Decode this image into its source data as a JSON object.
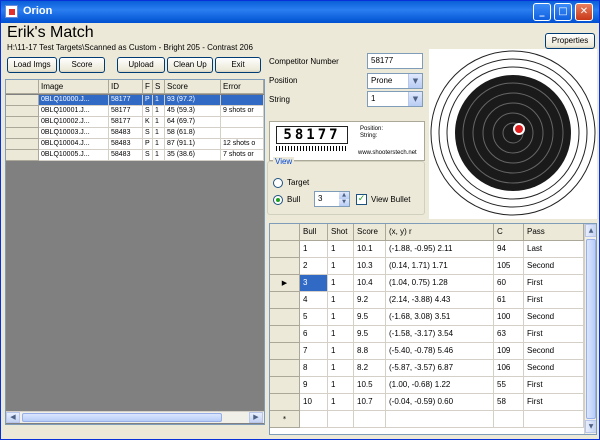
{
  "window": {
    "title": "Orion",
    "buttons": {
      "minimize": "_",
      "maximize": "□",
      "close": "✕"
    }
  },
  "header": {
    "title": "Erik's Match",
    "path": "H:\\11-17 Test Targets\\Scanned as Custom - Bright 205 - Contrast 206",
    "properties_label": "Properties"
  },
  "toolbar": {
    "load_label": "Load Imgs",
    "score_label": "Score",
    "upload_label": "Upload",
    "cleanup_label": "Clean Up",
    "exit_label": "Exit"
  },
  "image_list": {
    "columns": [
      "Image",
      "ID",
      "F",
      "S",
      "Score",
      "Error"
    ],
    "selected_index": 0,
    "rows": [
      {
        "image": "0BLQ10000.J...",
        "id": "58177",
        "f": "P",
        "s": "1",
        "score": "93 (97.2)",
        "error": ""
      },
      {
        "image": "0BLQ10001.J...",
        "id": "58177",
        "f": "S",
        "s": "1",
        "score": "45 (59.3)",
        "error": "9 shots or"
      },
      {
        "image": "0BLQ10002.J...",
        "id": "58177",
        "f": "K",
        "s": "1",
        "score": "64 (69.7)",
        "error": ""
      },
      {
        "image": "0BLQ10003.J...",
        "id": "58483",
        "f": "S",
        "s": "1",
        "score": "58 (61.8)",
        "error": ""
      },
      {
        "image": "0BLQ10004.J...",
        "id": "58483",
        "f": "P",
        "s": "1",
        "score": "87 (91.1)",
        "error": "12 shots o"
      },
      {
        "image": "0BLQ10005.J...",
        "id": "58483",
        "f": "S",
        "s": "1",
        "score": "35 (38.6)",
        "error": "7 shots or"
      }
    ]
  },
  "details": {
    "competitor_label": "Competitor Number",
    "competitor_value": "58177",
    "position_label": "Position",
    "position_value": "Prone",
    "string_label": "String",
    "string_value": "1",
    "scan_number": "58177",
    "scan_text1": "Position:",
    "scan_text2": "String:",
    "scan_url": "www.shooterstech.net"
  },
  "view": {
    "group_label": "View",
    "target_label": "Target",
    "bull_label": "Bull",
    "bull_value": "3",
    "view_bullet_label": "View Bullet",
    "selected": "bull",
    "view_bullet_checked": true
  },
  "shots": {
    "columns": [
      "Bull",
      "Shot",
      "Score",
      "(x, y) r",
      "C",
      "Pass"
    ],
    "current_row": 2,
    "rows": [
      {
        "bull": "1",
        "shot": "1",
        "score": "10.1",
        "xy": "(-1.88, -0.95) 2.11",
        "c": "94",
        "pass": "Last"
      },
      {
        "bull": "2",
        "shot": "1",
        "score": "10.3",
        "xy": "(0.14, 1.71) 1.71",
        "c": "105",
        "pass": "Second"
      },
      {
        "bull": "3",
        "shot": "1",
        "score": "10.4",
        "xy": "(1.04, 0.75) 1.28",
        "c": "60",
        "pass": "First"
      },
      {
        "bull": "4",
        "shot": "1",
        "score": "9.2",
        "xy": "(2.14, -3.88) 4.43",
        "c": "61",
        "pass": "First"
      },
      {
        "bull": "5",
        "shot": "1",
        "score": "9.5",
        "xy": "(-1.68, 3.08) 3.51",
        "c": "100",
        "pass": "Second"
      },
      {
        "bull": "6",
        "shot": "1",
        "score": "9.5",
        "xy": "(-1.58, -3.17) 3.54",
        "c": "63",
        "pass": "First"
      },
      {
        "bull": "7",
        "shot": "1",
        "score": "8.8",
        "xy": "(-5.40, -0.78) 5.46",
        "c": "109",
        "pass": "Second"
      },
      {
        "bull": "8",
        "shot": "1",
        "score": "8.2",
        "xy": "(-5.87, -3.57) 6.87",
        "c": "106",
        "pass": "Second"
      },
      {
        "bull": "9",
        "shot": "1",
        "score": "10.5",
        "xy": "(1.00, -0.68) 1.22",
        "c": "55",
        "pass": "First"
      },
      {
        "bull": "10",
        "shot": "1",
        "score": "10.7",
        "xy": "(-0.04, -0.59) 0.60",
        "c": "58",
        "pass": "First"
      }
    ],
    "new_row_marker": "*",
    "current_marker": "▶"
  }
}
